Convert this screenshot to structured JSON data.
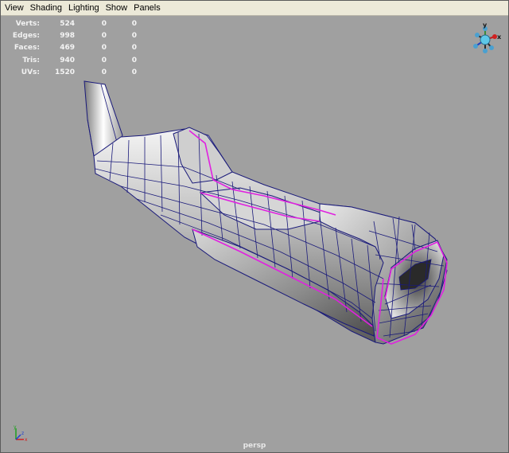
{
  "menu": {
    "items": [
      {
        "label": "View"
      },
      {
        "label": "Shading"
      },
      {
        "label": "Lighting"
      },
      {
        "label": "Show"
      },
      {
        "label": "Panels"
      }
    ]
  },
  "hud": {
    "rows": [
      {
        "label": "Verts:",
        "v1": "524",
        "v2": "0",
        "v3": "0"
      },
      {
        "label": "Edges:",
        "v1": "998",
        "v2": "0",
        "v3": "0"
      },
      {
        "label": "Faces:",
        "v1": "469",
        "v2": "0",
        "v3": "0"
      },
      {
        "label": "Tris:",
        "v1": "940",
        "v2": "0",
        "v3": "0"
      },
      {
        "label": "UVs:",
        "v1": "1520",
        "v2": "0",
        "v3": "0"
      }
    ]
  },
  "viewcube": {
    "x_label": "x",
    "y_label": "y"
  },
  "axis_indicator": {
    "x_label": "x",
    "y_label": "y",
    "z_label": "z"
  },
  "camera": {
    "label": "persp"
  },
  "colors": {
    "viewport_bg": "#a0a0a0",
    "wireframe": "#1a1a7a",
    "selection": "#e020e0",
    "hud_text": "#f4f4f4"
  }
}
